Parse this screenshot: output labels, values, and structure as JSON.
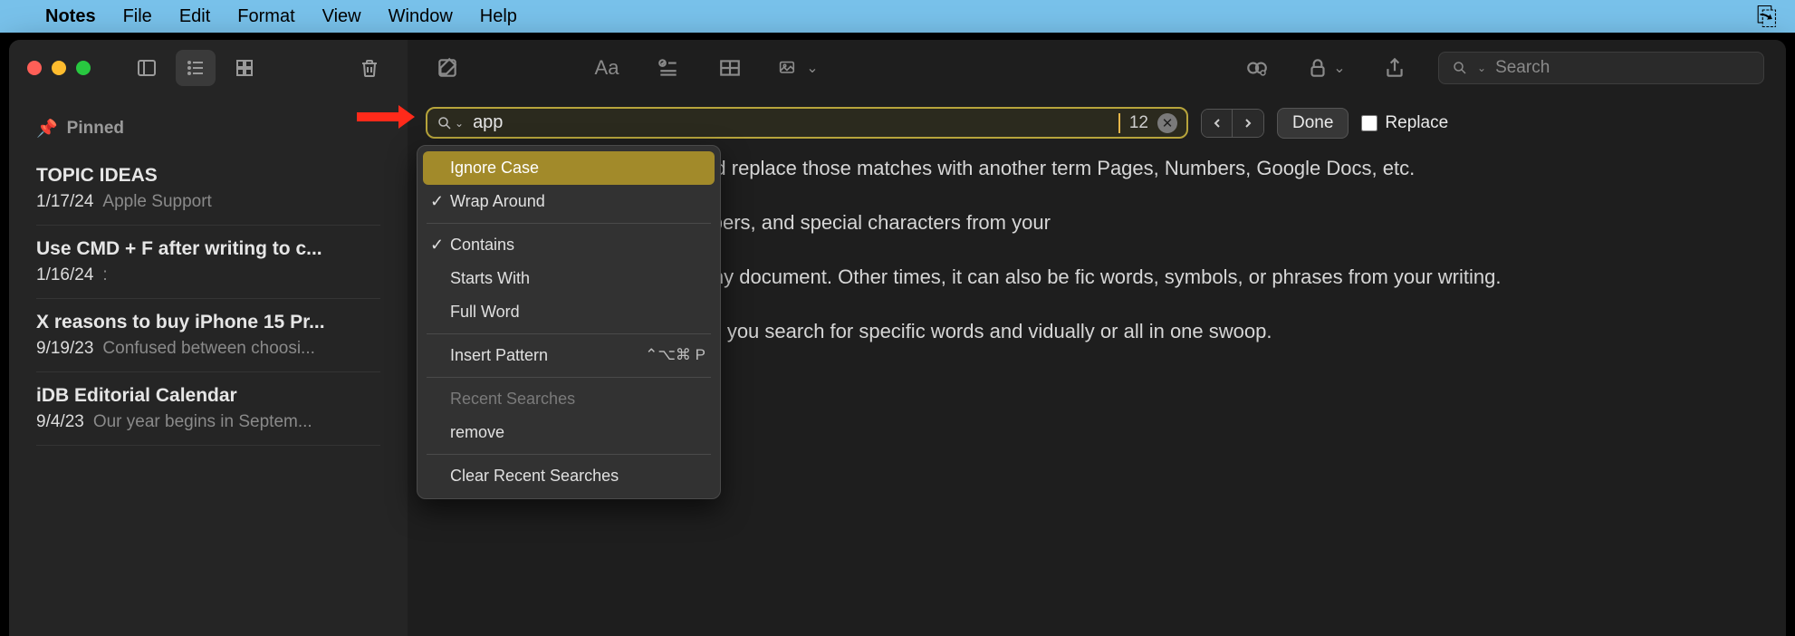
{
  "menubar": {
    "app": "Notes",
    "items": [
      "File",
      "Edit",
      "Format",
      "View",
      "Window",
      "Help"
    ]
  },
  "sidebar": {
    "pinned_label": "Pinned",
    "notes": [
      {
        "title": "TOPIC IDEAS",
        "date": "1/17/24",
        "preview": "Apple Support"
      },
      {
        "title": "Use CMD + F after writing to c...",
        "date": "1/16/24",
        "preview": ":"
      },
      {
        "title": "X reasons to buy iPhone 15 Pr...",
        "date": "9/19/23",
        "preview": "Confused between choosi..."
      },
      {
        "title": "iDB Editorial Calendar",
        "date": "9/4/23",
        "preview": "Our year begins in Septem..."
      }
    ]
  },
  "toolbar": {
    "search_placeholder": "Search"
  },
  "find": {
    "value": "app",
    "count": "12",
    "done": "Done",
    "replace_label": "Replace"
  },
  "dropdown": {
    "ignore_case": "Ignore Case",
    "wrap": "Wrap Around",
    "contains": "Contains",
    "starts": "Starts With",
    "full": "Full Word",
    "insert_pattern": "Insert Pattern",
    "insert_shortcut": "⌃⌥⌘ P",
    "recent_header": "Recent Searches",
    "recent_1": "remove",
    "clear": "Clear Recent Searches"
  },
  "document": {
    "p1": "or phrases in your document and replace those matches with another term Pages, Numbers, Google Docs, etc.",
    "p2": "o find and replace spaces, numbers, and special characters from your",
    "p3": "d or make corrections in a lengthy document. Other times, it can also be fic words, symbols, or phrases from your writing.",
    "p4": "d iPad, the Mac version also lets you search for specific words and vidually or all in one swoop."
  }
}
